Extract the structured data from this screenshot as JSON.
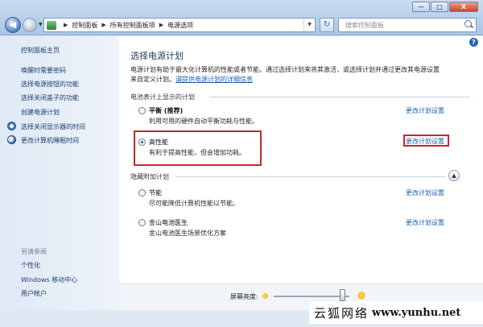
{
  "address": {
    "crumbs": [
      "控制面板",
      "所有控制面板项",
      "电源选项"
    ]
  },
  "search": {
    "placeholder": "搜索控制面板"
  },
  "window_buttons": {
    "minimize": "—",
    "maximize": "□",
    "close": "X"
  },
  "nav": {
    "back": "◀",
    "forward": "▶"
  },
  "sidebar": {
    "items": [
      {
        "label": "控制面板主页"
      },
      {
        "label": "唤醒时需要密码"
      },
      {
        "label": "选择电源按钮的功能"
      },
      {
        "label": "选择关闭盖子的功能"
      },
      {
        "label": "创建电源计划"
      },
      {
        "label": "选择关闭显示器的时间",
        "icon": "clock-icon"
      },
      {
        "label": "更改计算机睡眠时间",
        "icon": "moon-icon"
      }
    ],
    "see_also": "另请参阅",
    "see_also_items": [
      {
        "label": "个性化"
      },
      {
        "label": "Windows 移动中心"
      },
      {
        "label": "用户帐户"
      }
    ]
  },
  "main": {
    "help": "?",
    "title": "选择电源计划",
    "desc_line1": "电源计划有助于最大化计算机的性能或者节能。通过选择计划来将其激活，或选择计划并通过更改其电源设置",
    "desc_line2": "来自定义计划。",
    "desc_link": "谓提供电源计划的详细信息",
    "group1": "电池表计上显示的计划",
    "group2": "隐藏附加计划",
    "change_link": "更改计划设置",
    "plans": [
      {
        "name": "平衡 (推荐)",
        "desc": "利用可用的硬件自动平衡功耗与性能。",
        "selected": false
      },
      {
        "name": "高性能",
        "desc": "有利于提高性能，但会增加功耗。",
        "selected": true
      },
      {
        "name": "节能",
        "desc": "尽可能降低计算机性能以节能。",
        "selected": false
      },
      {
        "name": "金山电池医生",
        "desc": "金山电池医生场景优化方案",
        "selected": false
      }
    ]
  },
  "bottom": {
    "brightness_label": "屏幕亮度:",
    "brightness_level": 0.92
  },
  "watermark": {
    "name": "云狐网络",
    "domain": "www.yunhu.net"
  },
  "colors": {
    "highlight_box": "#c8262d",
    "link": "#1e5fb4",
    "title": "#1e395b"
  }
}
